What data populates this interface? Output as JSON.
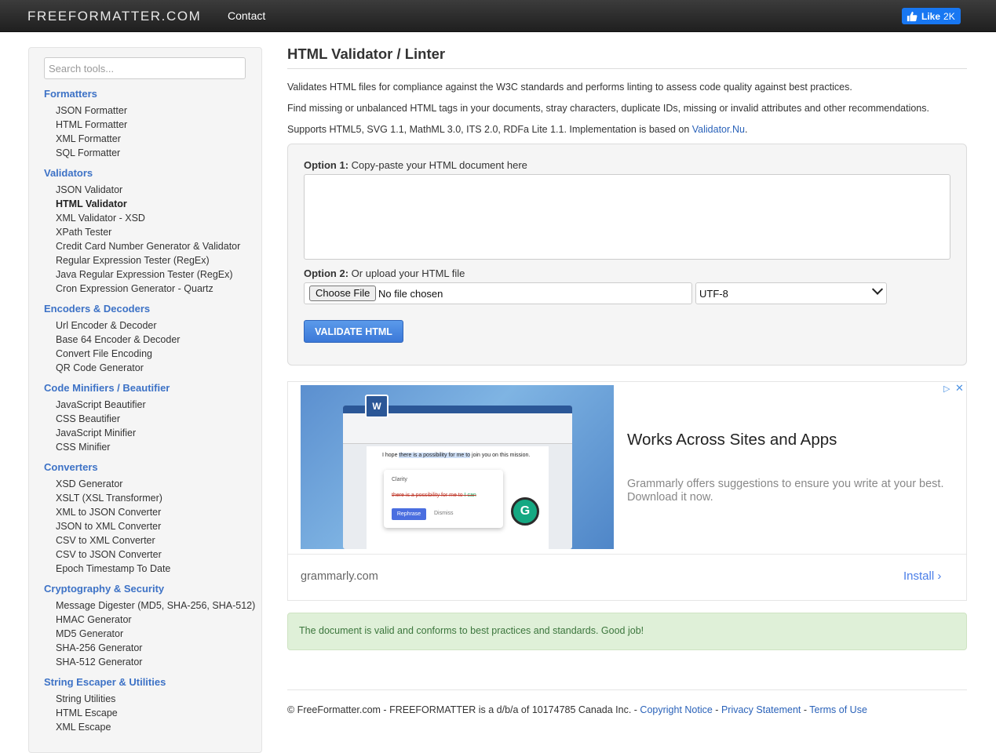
{
  "header": {
    "brand": "FREEFORMATTER.COM",
    "contact": "Contact",
    "like_label": "Like",
    "like_count": "2K"
  },
  "sidebar": {
    "search_placeholder": "Search tools...",
    "categories": [
      {
        "title": "Formatters",
        "items": [
          "JSON Formatter",
          "HTML Formatter",
          "XML Formatter",
          "SQL Formatter"
        ]
      },
      {
        "title": "Validators",
        "items": [
          "JSON Validator",
          "HTML Validator",
          "XML Validator - XSD",
          "XPath Tester",
          "Credit Card Number Generator & Validator",
          "Regular Expression Tester (RegEx)",
          "Java Regular Expression Tester (RegEx)",
          "Cron Expression Generator - Quartz"
        ]
      },
      {
        "title": "Encoders & Decoders",
        "items": [
          "Url Encoder & Decoder",
          "Base 64 Encoder & Decoder",
          "Convert File Encoding",
          "QR Code Generator"
        ]
      },
      {
        "title": "Code Minifiers / Beautifier",
        "items": [
          "JavaScript Beautifier",
          "CSS Beautifier",
          "JavaScript Minifier",
          "CSS Minifier"
        ]
      },
      {
        "title": "Converters",
        "items": [
          "XSD Generator",
          "XSLT (XSL Transformer)",
          "XML to JSON Converter",
          "JSON to XML Converter",
          "CSV to XML Converter",
          "CSV to JSON Converter",
          "Epoch Timestamp To Date"
        ]
      },
      {
        "title": "Cryptography & Security",
        "items": [
          "Message Digester (MD5, SHA-256, SHA-512)",
          "HMAC Generator",
          "MD5 Generator",
          "SHA-256 Generator",
          "SHA-512 Generator"
        ]
      },
      {
        "title": "String Escaper & Utilities",
        "items": [
          "String Utilities",
          "HTML Escape",
          "XML Escape"
        ]
      }
    ],
    "active_item": "HTML Validator"
  },
  "main": {
    "title": "HTML Validator / Linter",
    "desc1": "Validates HTML files for compliance against the W3C standards and performs linting to assess code quality against best practices.",
    "desc2": "Find missing or unbalanced HTML tags in your documents, stray characters, duplicate IDs, missing or invalid attributes and other recommendations.",
    "desc3_prefix": "Supports HTML5, SVG 1.1, MathML 3.0, ITS 2.0, RDFa Lite 1.1. Implementation is based on ",
    "desc3_link": "Validator.Nu",
    "desc3_suffix": ".",
    "option1_bold": "Option 1:",
    "option1_text": " Copy-paste your HTML document here",
    "option1_value": "",
    "option2_bold": "Option 2:",
    "option2_text": " Or upload your HTML file",
    "choose_file": "Choose File",
    "no_file": "No file chosen",
    "encoding": "UTF-8",
    "validate_button": "VALIDATE HTML"
  },
  "ad": {
    "headline": "Works Across Sites and Apps",
    "body": "Grammarly offers suggestions to ensure you write at your best. Download it now.",
    "domain": "grammarly.com",
    "install": "Install",
    "mock_sentence_prefix": "I hope ",
    "mock_sentence_highlight": "there is a possibility for me to",
    "mock_sentence_suffix": " join you on this mission.",
    "mock_clarity": "Clarity",
    "mock_strike": "there is a possibility for me to",
    "mock_replacement": " I can",
    "mock_rephrase": "Rephrase",
    "mock_dismiss": "Dismiss"
  },
  "result": {
    "message": "The document is valid and conforms to best practices and standards. Good job!"
  },
  "footer": {
    "prefix": "© FreeFormatter.com - FREEFORMATTER is a d/b/a of 10174785 Canada Inc. - ",
    "copyright": "Copyright Notice",
    "sep1": " - ",
    "privacy": "Privacy Statement",
    "sep2": " - ",
    "terms": "Terms of Use"
  },
  "colors": {
    "link": "#3d72c6",
    "success_bg": "#dff0d8",
    "button": "#3b78d8",
    "facebook": "#1877f2"
  }
}
